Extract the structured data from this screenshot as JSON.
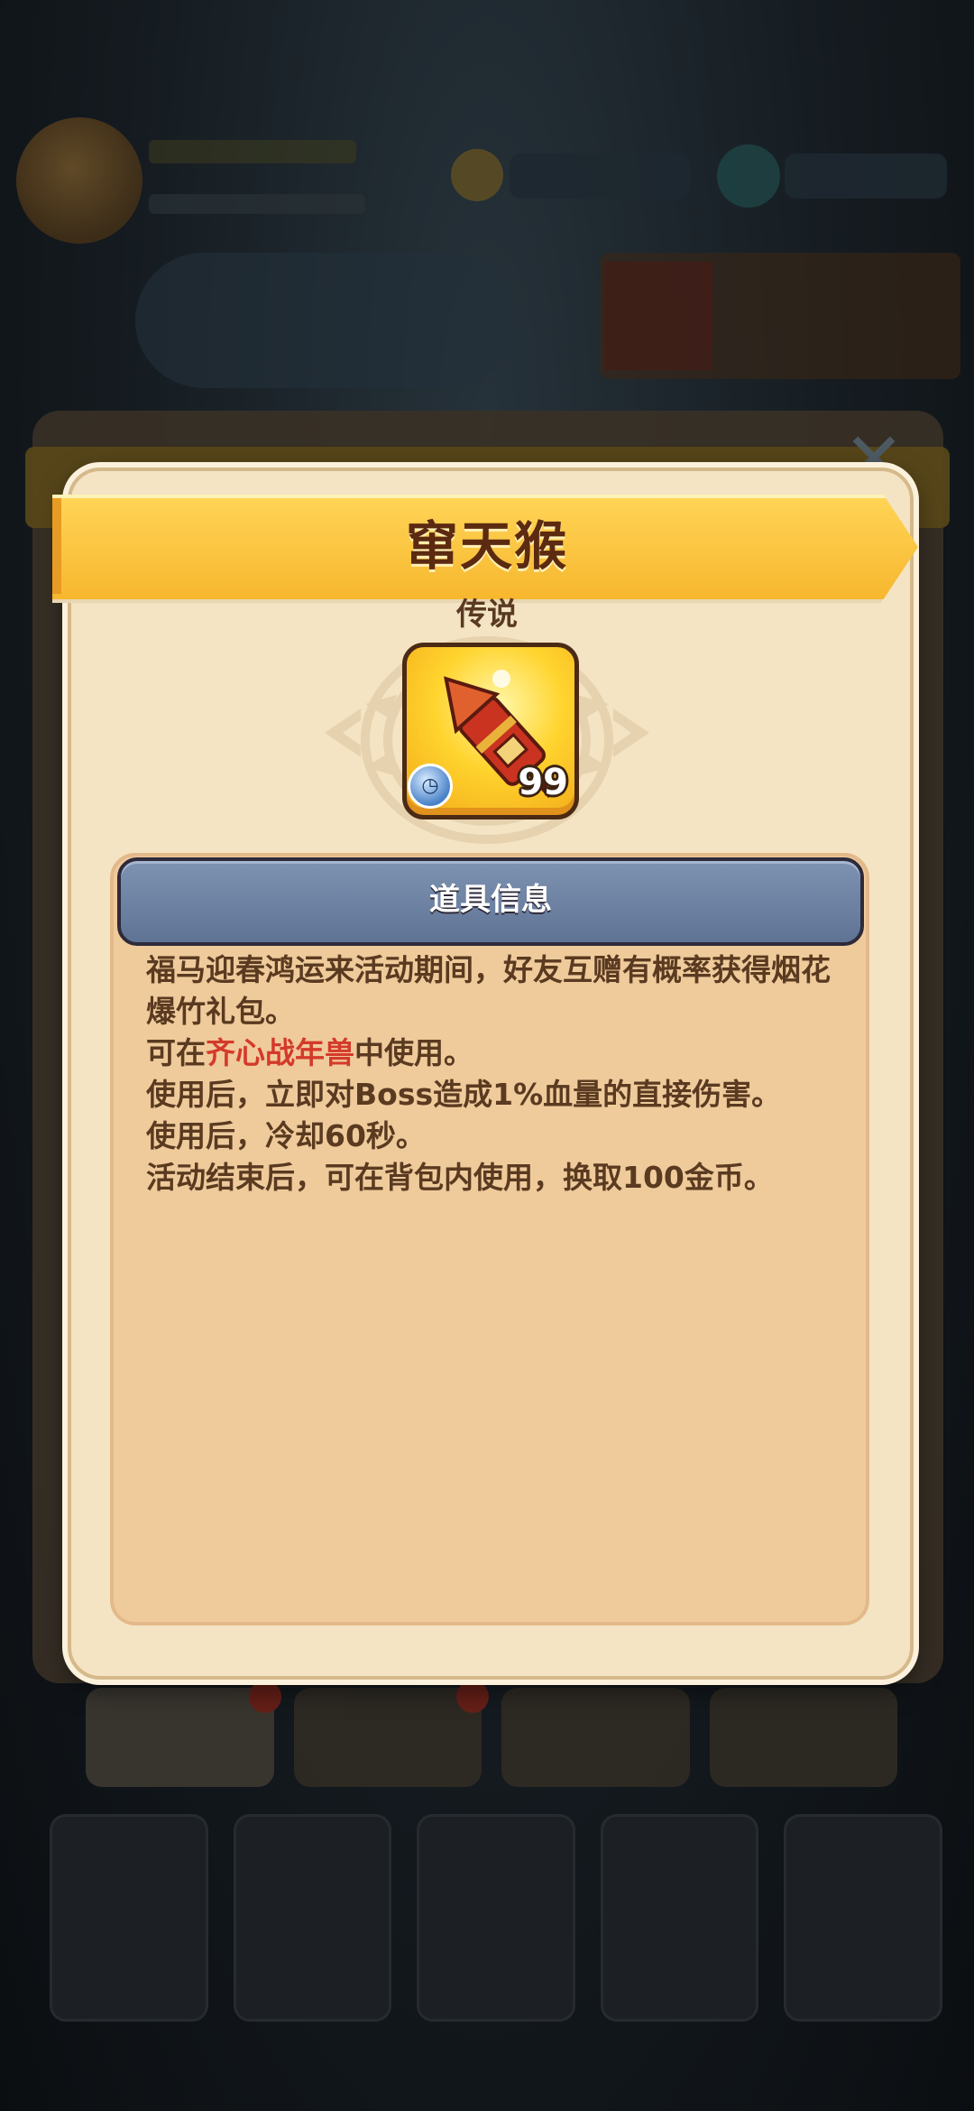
{
  "dialog": {
    "title": "窜天猴",
    "rarity": "传说",
    "item": {
      "icon": "firework-rocket-icon",
      "count": "99",
      "badge_icon": "clock-icon"
    },
    "info_header": "道具信息",
    "description": {
      "line1": "福马迎春鸿运来活动期间，好友互赠有概率获得烟花爆竹礼包。",
      "line2_prefix": "可在",
      "line2_highlight": "齐心战年兽",
      "line2_suffix": "中使用。",
      "line3": "使用后，立即对Boss造成1%血量的直接伤害。",
      "line4": "使用后，冷却60秒。",
      "line5": "活动结束后，可在背包内使用，换取100金币。"
    }
  },
  "colors": {
    "ribbon": "#f7b72e",
    "panel": "#f4e4c4",
    "info_header": "#6f83a4",
    "highlight": "#d43a2a"
  }
}
